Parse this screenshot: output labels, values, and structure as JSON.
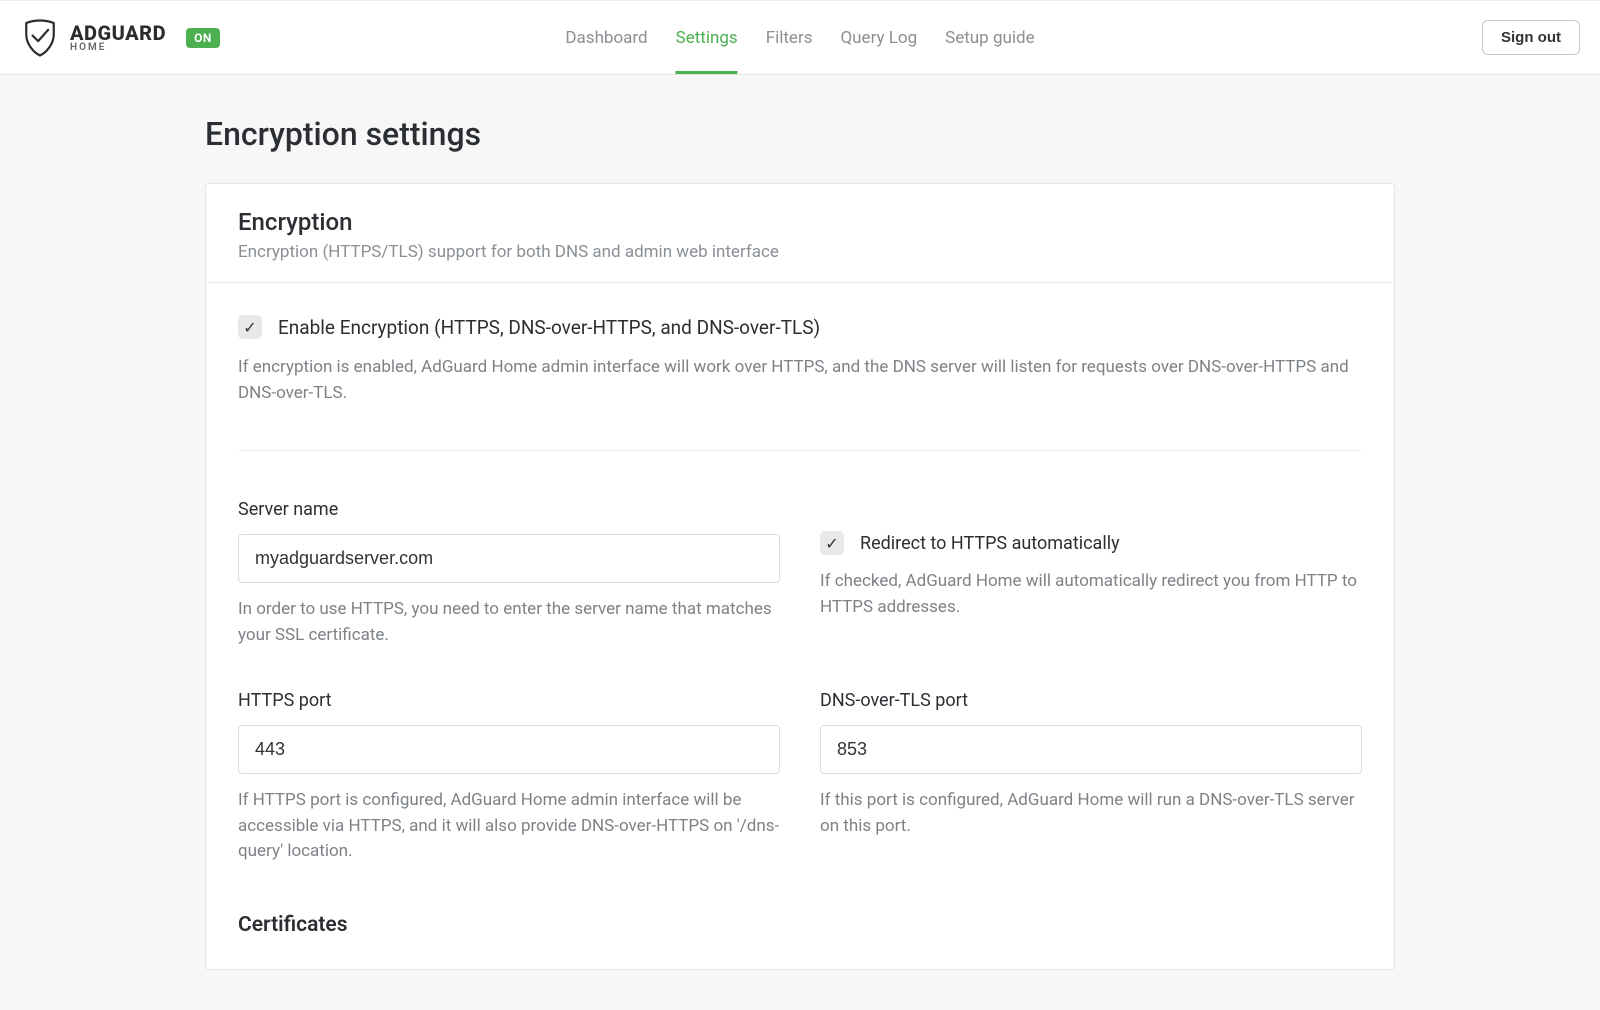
{
  "brand": {
    "main": "ADGUARD",
    "sub": "HOME",
    "status_badge": "ON"
  },
  "nav": {
    "items": [
      {
        "label": "Dashboard",
        "active": false
      },
      {
        "label": "Settings",
        "active": true
      },
      {
        "label": "Filters",
        "active": false
      },
      {
        "label": "Query Log",
        "active": false
      },
      {
        "label": "Setup guide",
        "active": false
      }
    ],
    "signout": "Sign out"
  },
  "page": {
    "title": "Encryption settings"
  },
  "panel": {
    "title": "Encryption",
    "subtitle": "Encryption (HTTPS/TLS) support for both DNS and admin web interface",
    "enable": {
      "label": "Enable Encryption (HTTPS, DNS-over-HTTPS, and DNS-over-TLS)",
      "checked": true,
      "help": "If encryption is enabled, AdGuard Home admin interface will work over HTTPS, and the DNS server will listen for requests over DNS-over-HTTPS and DNS-over-TLS."
    },
    "server_name": {
      "label": "Server name",
      "value": "myadguardserver.com",
      "help": "In order to use HTTPS, you need to enter the server name that matches your SSL certificate."
    },
    "redirect": {
      "label": "Redirect to HTTPS automatically",
      "checked": true,
      "help": "If checked, AdGuard Home will automatically redirect you from HTTP to HTTPS addresses."
    },
    "https_port": {
      "label": "HTTPS port",
      "value": "443",
      "help": "If HTTPS port is configured, AdGuard Home admin interface will be accessible via HTTPS, and it will also provide DNS-over-HTTPS on '/dns-query' location."
    },
    "dot_port": {
      "label": "DNS-over-TLS port",
      "value": "853",
      "help": "If this port is configured, AdGuard Home will run a DNS-over-TLS server on this port."
    },
    "certificates": {
      "title": "Certificates"
    }
  }
}
